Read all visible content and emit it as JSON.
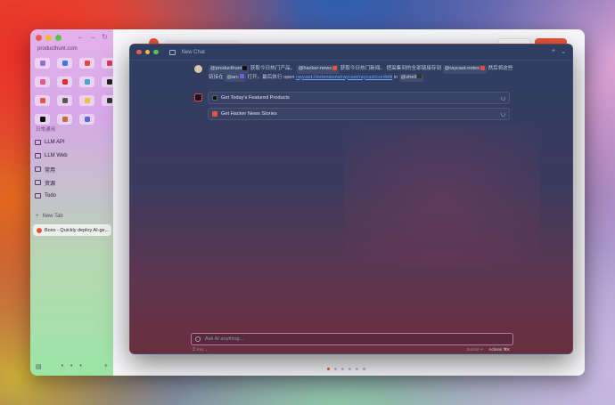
{
  "browser": {
    "url": "producthunt.com",
    "favorites": [
      {
        "icon": "app-icon-purple",
        "color": "#9a6ad8"
      },
      {
        "icon": "app-icon-blue",
        "color": "#3a7be0"
      },
      {
        "icon": "app-icon-red",
        "color": "#e64a3a"
      },
      {
        "icon": "app-icon-red2",
        "color": "#d83a5a"
      },
      {
        "icon": "app-icon-pink",
        "color": "#e85a8a"
      },
      {
        "icon": "youtube-icon",
        "color": "#e62a2a"
      },
      {
        "icon": "app-icon-teal",
        "color": "#3aa8d8"
      },
      {
        "icon": "x-icon",
        "color": "#222222"
      },
      {
        "icon": "app-icon-orange",
        "color": "#e8563a"
      },
      {
        "icon": "play-icon",
        "color": "#555555"
      },
      {
        "icon": "app-icon-yellow",
        "color": "#e8c23a"
      },
      {
        "icon": "app-icon-dark",
        "color": "#333333"
      },
      {
        "icon": "tiktok-icon",
        "color": "#111111"
      },
      {
        "icon": "app-icon-multi",
        "color": "#c86a3a"
      },
      {
        "icon": "app-icon-indigo",
        "color": "#5a6ad8"
      }
    ],
    "section_label": "日常通用",
    "folders": [
      "LLM API",
      "LLM Web",
      "常用",
      "资源",
      "Todo"
    ],
    "new_tab_label": "New Tab",
    "active_tab": "Boxo - Quickly deploy AI-ge..."
  },
  "chat": {
    "window_title": "New Chat",
    "user_message": {
      "part1": "获取今日热门产品，",
      "part2": "获取今日热门新闻。 把采集到的全部链接存到",
      "part3": "然后将这些链接在",
      "part4": "打开。最后执行 open",
      "link": "raycast://extensions/raycast/raycast/confetti",
      "part5": "in",
      "tags": {
        "producthunt": "@producthunt",
        "hackernews": "@hacker-news",
        "raycastnotes": "@raycast-notes",
        "arc": "@arc",
        "shell": "@shell"
      }
    },
    "tools": [
      {
        "label": "Get Today's Featured Products",
        "icon_color": "#111111"
      },
      {
        "label": "Get Hacker News Stories",
        "icon_color": "#e8563a"
      }
    ],
    "input_placeholder": "Ask AI anything...",
    "footer_left": "Key",
    "footer_submit": "Submit ↵",
    "footer_actions": "Actions ⌘K"
  }
}
